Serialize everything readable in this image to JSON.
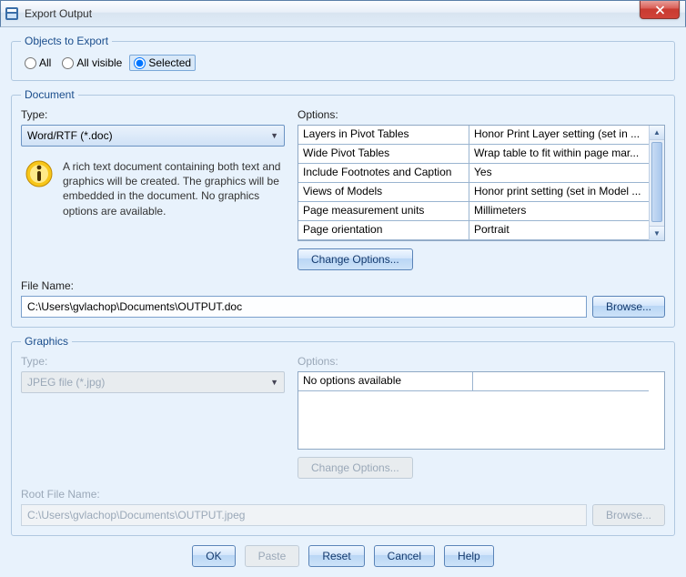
{
  "window": {
    "title": "Export Output"
  },
  "objects": {
    "legend": "Objects to Export",
    "all": "All",
    "all_visible": "All visible",
    "selected": "Selected",
    "choice": "selected"
  },
  "document": {
    "legend": "Document",
    "type_label": "Type:",
    "type_value": "Word/RTF (*.doc)",
    "desc": "A rich text document containing both text and graphics will be created. The graphics will be embedded in the document. No graphics options are available.",
    "options_label": "Options:",
    "change_options": "Change Options...",
    "options": [
      {
        "k": "Layers in Pivot Tables",
        "v": "Honor Print Layer setting (set in ..."
      },
      {
        "k": "Wide Pivot Tables",
        "v": "Wrap table to fit within page mar..."
      },
      {
        "k": "Include Footnotes and Caption",
        "v": "Yes"
      },
      {
        "k": "Views of Models",
        "v": "Honor print setting (set in Model ..."
      },
      {
        "k": "Page measurement units",
        "v": "Millimeters"
      },
      {
        "k": "Page orientation",
        "v": "Portrait"
      }
    ],
    "filename_label": "File Name:",
    "filename": "C:\\Users\\gvlachop\\Documents\\OUTPUT.doc",
    "browse": "Browse..."
  },
  "graphics": {
    "legend": "Graphics",
    "type_label": "Type:",
    "type_value": "JPEG file (*.jpg)",
    "options_label": "Options:",
    "no_options": "No options available",
    "change_options": "Change Options...",
    "rootfile_label": "Root File Name:",
    "rootfile": "C:\\Users\\gvlachop\\Documents\\OUTPUT.jpeg",
    "browse": "Browse..."
  },
  "footer": {
    "ok": "OK",
    "paste": "Paste",
    "reset": "Reset",
    "cancel": "Cancel",
    "help": "Help"
  }
}
